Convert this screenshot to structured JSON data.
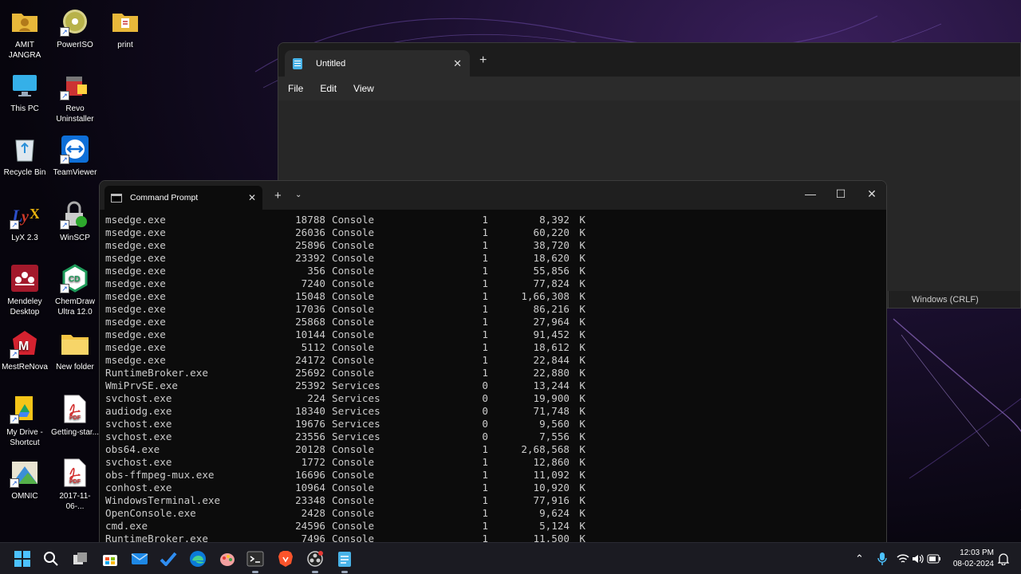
{
  "desktop": {
    "icons": [
      {
        "label": "AMIT JANGRA"
      },
      {
        "label": "PowerISO"
      },
      {
        "label": "print"
      },
      {
        "label": "This PC"
      },
      {
        "label": "Revo Uninstaller"
      },
      {
        "label": "Recycle Bin"
      },
      {
        "label": "TeamViewer"
      },
      {
        "label": "LyX 2.3"
      },
      {
        "label": "WinSCP"
      },
      {
        "label": "Mendeley Desktop"
      },
      {
        "label": "ChemDraw Ultra 12.0"
      },
      {
        "label": "MestReNova"
      },
      {
        "label": "New folder"
      },
      {
        "label": "My Drive - Shortcut"
      },
      {
        "label": "Getting-star..."
      },
      {
        "label": "OMNIC"
      },
      {
        "label": "2017-11-06-..."
      }
    ]
  },
  "notepad": {
    "tab_title": "Untitled",
    "close_glyph": "✕",
    "new_tab_glyph": "+",
    "menu": {
      "file": "File",
      "edit": "Edit",
      "view": "View"
    },
    "status_encoding": "Windows (CRLF)"
  },
  "cmd": {
    "tab_title": "Command Prompt",
    "close_glyph": "✕",
    "new_tab_glyph": "+",
    "dropdown_glyph": "⌄",
    "minimize_glyph": "—",
    "maximize_glyph": "☐",
    "window_close_glyph": "✕",
    "rows": [
      {
        "name": "msedge.exe",
        "pid": "18788",
        "sname": "Console",
        "sess": "1",
        "mem": "8,392",
        "unit": "K"
      },
      {
        "name": "msedge.exe",
        "pid": "26036",
        "sname": "Console",
        "sess": "1",
        "mem": "60,220",
        "unit": "K"
      },
      {
        "name": "msedge.exe",
        "pid": "25896",
        "sname": "Console",
        "sess": "1",
        "mem": "38,720",
        "unit": "K"
      },
      {
        "name": "msedge.exe",
        "pid": "23392",
        "sname": "Console",
        "sess": "1",
        "mem": "18,620",
        "unit": "K"
      },
      {
        "name": "msedge.exe",
        "pid": "356",
        "sname": "Console",
        "sess": "1",
        "mem": "55,856",
        "unit": "K"
      },
      {
        "name": "msedge.exe",
        "pid": "7240",
        "sname": "Console",
        "sess": "1",
        "mem": "77,824",
        "unit": "K"
      },
      {
        "name": "msedge.exe",
        "pid": "15048",
        "sname": "Console",
        "sess": "1",
        "mem": "1,66,308",
        "unit": "K"
      },
      {
        "name": "msedge.exe",
        "pid": "17036",
        "sname": "Console",
        "sess": "1",
        "mem": "86,216",
        "unit": "K"
      },
      {
        "name": "msedge.exe",
        "pid": "25868",
        "sname": "Console",
        "sess": "1",
        "mem": "27,964",
        "unit": "K"
      },
      {
        "name": "msedge.exe",
        "pid": "10144",
        "sname": "Console",
        "sess": "1",
        "mem": "91,452",
        "unit": "K"
      },
      {
        "name": "msedge.exe",
        "pid": "5112",
        "sname": "Console",
        "sess": "1",
        "mem": "18,612",
        "unit": "K"
      },
      {
        "name": "msedge.exe",
        "pid": "24172",
        "sname": "Console",
        "sess": "1",
        "mem": "22,844",
        "unit": "K"
      },
      {
        "name": "RuntimeBroker.exe",
        "pid": "25692",
        "sname": "Console",
        "sess": "1",
        "mem": "22,880",
        "unit": "K"
      },
      {
        "name": "WmiPrvSE.exe",
        "pid": "25392",
        "sname": "Services",
        "sess": "0",
        "mem": "13,244",
        "unit": "K"
      },
      {
        "name": "svchost.exe",
        "pid": "224",
        "sname": "Services",
        "sess": "0",
        "mem": "19,900",
        "unit": "K"
      },
      {
        "name": "audiodg.exe",
        "pid": "18340",
        "sname": "Services",
        "sess": "0",
        "mem": "71,748",
        "unit": "K"
      },
      {
        "name": "svchost.exe",
        "pid": "19676",
        "sname": "Services",
        "sess": "0",
        "mem": "9,560",
        "unit": "K"
      },
      {
        "name": "svchost.exe",
        "pid": "23556",
        "sname": "Services",
        "sess": "0",
        "mem": "7,556",
        "unit": "K"
      },
      {
        "name": "obs64.exe",
        "pid": "20128",
        "sname": "Console",
        "sess": "1",
        "mem": "2,68,568",
        "unit": "K"
      },
      {
        "name": "svchost.exe",
        "pid": "1772",
        "sname": "Console",
        "sess": "1",
        "mem": "12,860",
        "unit": "K"
      },
      {
        "name": "obs-ffmpeg-mux.exe",
        "pid": "16696",
        "sname": "Console",
        "sess": "1",
        "mem": "11,092",
        "unit": "K"
      },
      {
        "name": "conhost.exe",
        "pid": "10964",
        "sname": "Console",
        "sess": "1",
        "mem": "10,920",
        "unit": "K"
      },
      {
        "name": "WindowsTerminal.exe",
        "pid": "23348",
        "sname": "Console",
        "sess": "1",
        "mem": "77,916",
        "unit": "K"
      },
      {
        "name": "OpenConsole.exe",
        "pid": "2428",
        "sname": "Console",
        "sess": "1",
        "mem": "9,624",
        "unit": "K"
      },
      {
        "name": "cmd.exe",
        "pid": "24596",
        "sname": "Console",
        "sess": "1",
        "mem": "5,124",
        "unit": "K"
      },
      {
        "name": "RuntimeBroker.exe",
        "pid": "7496",
        "sname": "Console",
        "sess": "1",
        "mem": "11,500",
        "unit": "K"
      }
    ]
  },
  "taskbar": {
    "icons": [
      "start-icon",
      "search-icon",
      "task-view-icon",
      "microsoft-store-icon",
      "mail-icon",
      "todo-icon",
      "edge-icon",
      "paint-icon",
      "terminal-icon",
      "brave-icon",
      "obs-icon",
      "notepad-icon"
    ],
    "tray_chevron": "⌃",
    "time": "12:03 PM",
    "date": "08-02-2024"
  },
  "colors": {
    "terminal_bg": "#0c0c0c",
    "terminal_text": "#cccccc",
    "taskbar_bg": "#1b1b22"
  }
}
